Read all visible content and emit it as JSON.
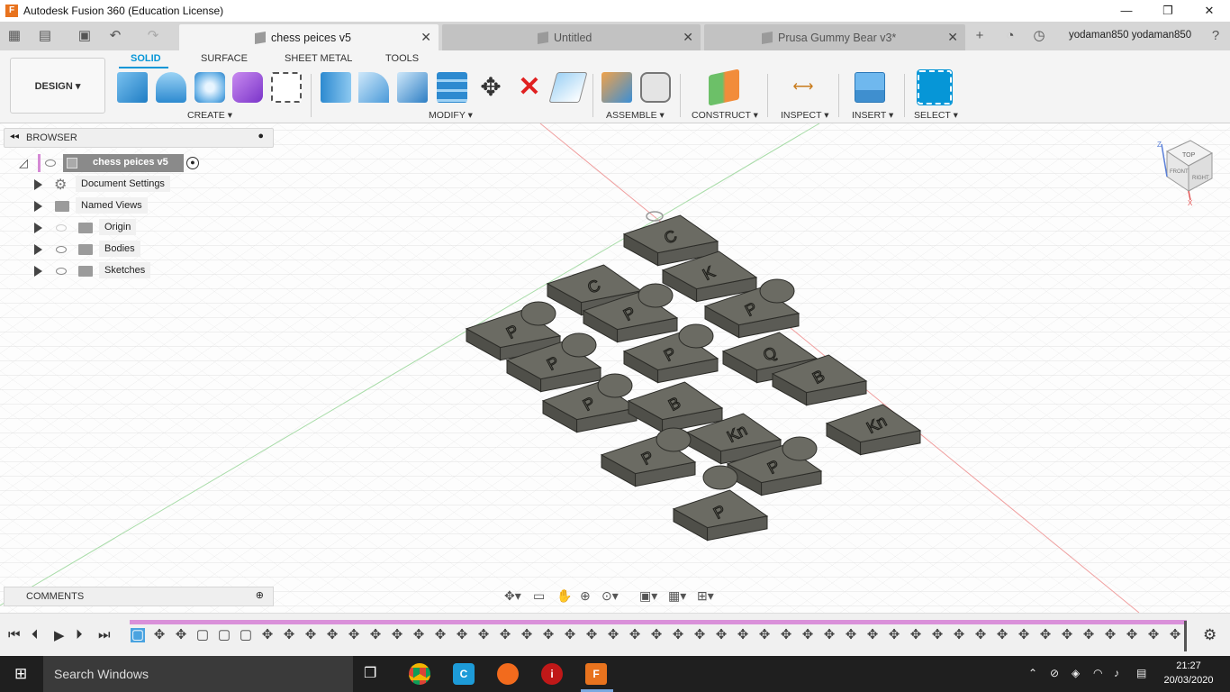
{
  "window": {
    "title": "Autodesk Fusion 360 (Education License)",
    "minimize": "—",
    "restore": "❐",
    "close": "✕"
  },
  "tabs": [
    {
      "label": "chess peices v5",
      "active": true
    },
    {
      "label": "Untitled",
      "active": false
    },
    {
      "label": "Prusa Gummy Bear v3*",
      "active": false
    }
  ],
  "user": {
    "name": "yodaman850 yodaman850"
  },
  "toolbar": {
    "workspace": "DESIGN",
    "ribbon_tabs": [
      "SOLID",
      "SURFACE",
      "SHEET METAL",
      "TOOLS"
    ],
    "groups": [
      "CREATE",
      "MODIFY",
      "ASSEMBLE",
      "CONSTRUCT",
      "INSPECT",
      "INSERT",
      "SELECT"
    ]
  },
  "browser": {
    "title": "BROWSER",
    "root": "chess peices v5",
    "items": [
      "Document Settings",
      "Named Views",
      "Origin",
      "Bodies",
      "Sketches"
    ]
  },
  "comments": {
    "title": "COMMENTS"
  },
  "viewcube": {
    "top": "TOP",
    "front": "FRONT",
    "right": "RIGHT",
    "z": "Z",
    "x": "X"
  },
  "taskbar": {
    "search_placeholder": "Search Windows",
    "time": "21:27",
    "date": "20/03/2020"
  },
  "pieces": [
    {
      "label": "C"
    },
    {
      "label": "C"
    },
    {
      "label": "K"
    },
    {
      "label": "P"
    },
    {
      "label": "P"
    },
    {
      "label": "P"
    },
    {
      "label": "P"
    },
    {
      "label": "P"
    },
    {
      "label": "Q"
    },
    {
      "label": "P"
    },
    {
      "label": "B"
    },
    {
      "label": "B"
    },
    {
      "label": "Kn"
    },
    {
      "label": "Kn"
    },
    {
      "label": "P"
    },
    {
      "label": "P"
    },
    {
      "label": "P"
    }
  ],
  "colors": {
    "accent": "#0696d7",
    "timeline": "#d990d9",
    "piece": "#6b6b63"
  }
}
